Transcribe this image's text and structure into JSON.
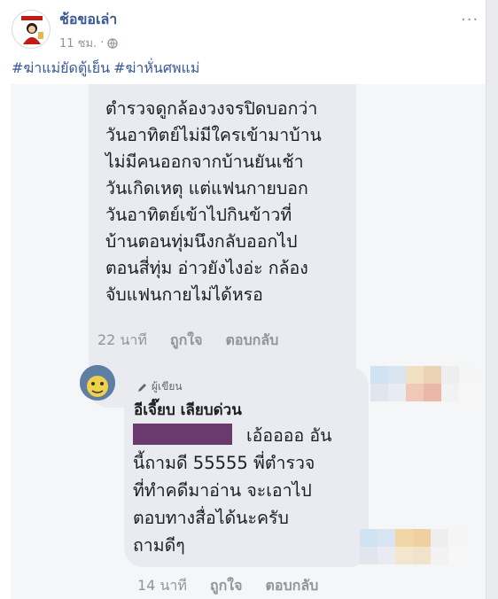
{
  "post": {
    "page_name": "ช้อขอเล่า",
    "time": "11 ชม.",
    "separator": "·",
    "hashtags": [
      "#ฆ่าแม่ยัดตู้เย็น",
      "#ฆ่าหั่นศพแม่"
    ],
    "more_label": "···"
  },
  "comment1": {
    "lines": [
      "ตำรวจดูกล้องวงจรปิดบอกว่า",
      "วันอาทิตย์ไม่มีใครเข้ามาบ้าน",
      "ไม่มีคนออกจากบ้านยันเช้า",
      "วันเกิดเหตุ แต่แฟนกายบอก",
      "วันอาทิตย์เข้าไปกินข้าวที่",
      "บ้านตอนทุ่มนึงกลับออกไป",
      "ตอนสี่ทุ่ม อ่าวยังไงอ่ะ กล้อง",
      "จับแฟนกายไม่ได้หรอ"
    ],
    "time": "22 นาที",
    "like": "ถูกใจ",
    "reply": "ตอบกลับ"
  },
  "comment2": {
    "badge": "ผู้เขียน",
    "author": "อีเจี๊ยบ เลียบด่วน",
    "lines": [
      "เอ้ออออ อัน",
      "นี้ถามดี 55555 พี่ตำรวจ",
      "ที่ทำคดีมาอ่าน จะเอาไป",
      "ตอบทางสื่อได้นะครับ",
      "ถามดีๆ"
    ],
    "time": "14 นาที",
    "like": "ถูกใจ",
    "reply": "ตอบกลับ"
  },
  "icons": {
    "more": "more-icon",
    "globe": "globe-icon",
    "pencil": "pencil-icon"
  },
  "colors": {
    "link": "#385898",
    "meta": "#90949c",
    "bubble": "#eaebf0",
    "redaction": "#6a3a6e"
  }
}
